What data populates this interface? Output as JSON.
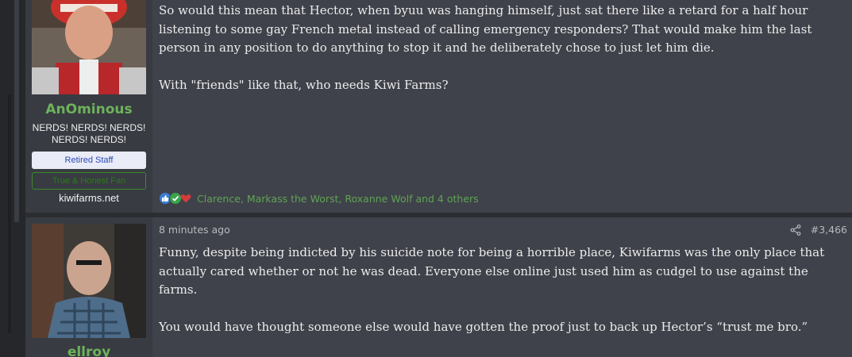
{
  "posts": [
    {
      "username": "AnOminous",
      "user_title_line1": "NERDS! NERDS! NERDS!",
      "user_title_line2": "NERDS! NERDS!",
      "banner_retired": "Retired Staff",
      "banner_fan": "True & Honest Fan",
      "user_site": "kiwifarms.net",
      "paragraphs": [
        "So would this mean that Hector, when byuu was hanging himself, just sat there like a retard for a half hour listening to some gay French metal instead of calling emergency responders? That would make him the last person in any position to do anything to stop it and he deliberately chose to just let him die.",
        "With \"friends\" like that, who needs Kiwi Farms?"
      ],
      "reactions_text": "Clarence, Markass the Worst, Roxanne Wolf and 4 others",
      "reaction_icons": [
        "like-icon",
        "check-icon",
        "heart-icon"
      ]
    },
    {
      "username": "ellroy",
      "timestamp": "8 minutes ago",
      "post_number": "#3,466",
      "paragraphs": [
        "Funny, despite being indicted by his suicide note for being a horrible place, Kiwifarms was the only place that actually cared whether or not he was dead. Everyone else online just used him as cudgel to use against the farms.",
        "You would have thought someone else would have gotten the proof just to back up Hector’s “trust me bro.”"
      ]
    }
  ],
  "colors": {
    "username": "#6db35a",
    "reaction_text": "#5fa354",
    "post_bg": "#3f424a",
    "user_col_bg": "#383b42"
  }
}
